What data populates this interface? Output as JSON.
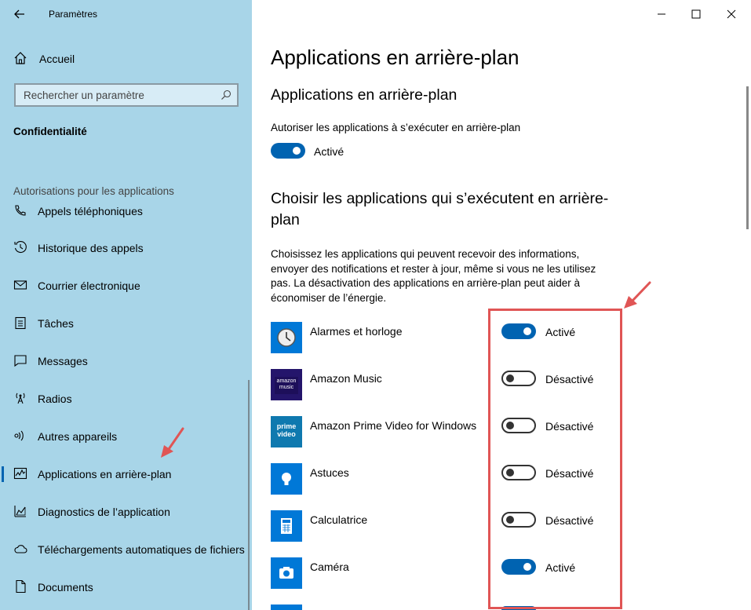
{
  "window": {
    "title": "Paramètres"
  },
  "sidebar": {
    "home_label": "Accueil",
    "search_placeholder": "Rechercher un paramètre",
    "section": "Confidentialité",
    "group_label": "Autorisations pour les applications",
    "items": [
      {
        "label": "Appels téléphoniques",
        "icon": "phone-icon"
      },
      {
        "label": "Historique des appels",
        "icon": "history-icon"
      },
      {
        "label": "Courrier électronique",
        "icon": "mail-icon"
      },
      {
        "label": "Tâches",
        "icon": "tasks-icon"
      },
      {
        "label": "Messages",
        "icon": "message-icon"
      },
      {
        "label": "Radios",
        "icon": "radio-icon"
      },
      {
        "label": "Autres appareils",
        "icon": "devices-icon"
      },
      {
        "label": "Applications en arrière-plan",
        "icon": "background-apps-icon",
        "active": true
      },
      {
        "label": "Diagnostics de l’application",
        "icon": "diagnostics-icon"
      },
      {
        "label": "Téléchargements automatiques de fichiers",
        "icon": "cloud-icon"
      },
      {
        "label": "Documents",
        "icon": "document-icon"
      }
    ]
  },
  "main": {
    "page_title": "Applications en arrière-plan",
    "section_title": "Applications en arrière-plan",
    "allow_label": "Autoriser les applications à s’exécuter en arrière-plan",
    "allow_state": "Activé",
    "choose_title": "Choisir les applications qui s’exécutent en arrière-plan",
    "description": "Choisissez les applications qui peuvent recevoir des informations, envoyer des notifications et rester à jour, même si vous ne les utilisez pas. La désactivation des applications en arrière-plan peut aider à économiser de l’énergie.",
    "apps": [
      {
        "name": "Alarmes et horloge",
        "state": "Activé",
        "on": true,
        "icon": "clock-icon",
        "color": "#0078d7"
      },
      {
        "name": "Amazon Music",
        "state": "Désactivé",
        "on": false,
        "icon": "amazon-music-icon",
        "color": "#24156b",
        "icon_text": "amazon music"
      },
      {
        "name": "Amazon Prime Video for Windows",
        "state": "Désactivé",
        "on": false,
        "icon": "prime-video-icon",
        "color": "#0f79af",
        "icon_text": "prime video"
      },
      {
        "name": "Astuces",
        "state": "Désactivé",
        "on": false,
        "icon": "lightbulb-icon",
        "color": "#0078d7"
      },
      {
        "name": "Calculatrice",
        "state": "Désactivé",
        "on": false,
        "icon": "calculator-icon",
        "color": "#0078d7"
      },
      {
        "name": "Caméra",
        "state": "Activé",
        "on": true,
        "icon": "camera-icon",
        "color": "#0078d7"
      }
    ]
  },
  "colors": {
    "sidebar_bg": "#a8d5e8",
    "accent": "#0063b1",
    "highlight": "#e05555"
  }
}
